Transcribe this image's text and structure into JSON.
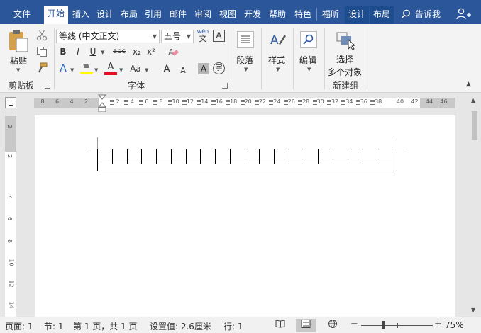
{
  "tabs": [
    {
      "label": "文件",
      "name": "tab-file"
    },
    {
      "label": "开始",
      "name": "tab-home",
      "active": true
    },
    {
      "label": "插入",
      "name": "tab-insert"
    },
    {
      "label": "设计",
      "name": "tab-design"
    },
    {
      "label": "布局",
      "name": "tab-layout"
    },
    {
      "label": "引用",
      "name": "tab-references"
    },
    {
      "label": "邮件",
      "name": "tab-mailings"
    },
    {
      "label": "审阅",
      "name": "tab-review"
    },
    {
      "label": "视图",
      "name": "tab-view"
    },
    {
      "label": "开发",
      "name": "tab-developer"
    },
    {
      "label": "帮助",
      "name": "tab-help"
    },
    {
      "label": "特色",
      "name": "tab-features"
    },
    {
      "label": "福昕",
      "name": "tab-foxit"
    },
    {
      "label": "设计",
      "name": "tab-table-design"
    },
    {
      "label": "布局",
      "name": "tab-table-layout"
    }
  ],
  "tell_me": {
    "label": "告诉我"
  },
  "ribbon": {
    "clipboard": {
      "paste_label": "粘贴",
      "group_label": "剪贴板"
    },
    "font": {
      "font_name": "等线 (中文正文)",
      "font_size": "五号",
      "bold": "B",
      "italic": "I",
      "underline": "U",
      "strike": "abc",
      "subscript": "x₂",
      "superscript": "x²",
      "wen_label": "wén",
      "wen_char": "文",
      "text_effects": "A",
      "font_color": "A",
      "case": "Aa",
      "grow": "A",
      "shrink": "A",
      "char_shading": "A",
      "enclose": "字",
      "group_label": "字体"
    },
    "paragraph": {
      "label": "段落"
    },
    "styles": {
      "label": "样式"
    },
    "editing": {
      "label": "编辑"
    },
    "select_objects": {
      "label_line1": "选择",
      "label_line2": "多个对象"
    },
    "new_group": {
      "label": "新建组"
    }
  },
  "ruler": {
    "numbers_left": [
      "8",
      "6",
      "4",
      "2"
    ],
    "numbers_mid": [
      "2",
      "4",
      "6",
      "8",
      "10",
      "12",
      "14",
      "16",
      "18",
      "20",
      "22",
      "24",
      "26",
      "28",
      "30",
      "32",
      "34",
      "36",
      "38"
    ],
    "numbers_right": [
      "40",
      "42",
      "44",
      "46"
    ],
    "vertical": [
      "2",
      "2",
      "4",
      "6",
      "8",
      "10",
      "12",
      "14"
    ]
  },
  "table": {
    "columns": 20
  },
  "status": {
    "page": "页面: 1",
    "section": "节: 1",
    "page_of": "第 1 页，共 1 页",
    "setting": "设置值: 2.6厘米",
    "line": "行: 1",
    "zoom": "75%",
    "zoom_level": 0.75
  },
  "colors": {
    "ribbon_blue": "#2b579a",
    "highlight_yellow": "#ffff00",
    "font_red": "#e81123"
  }
}
